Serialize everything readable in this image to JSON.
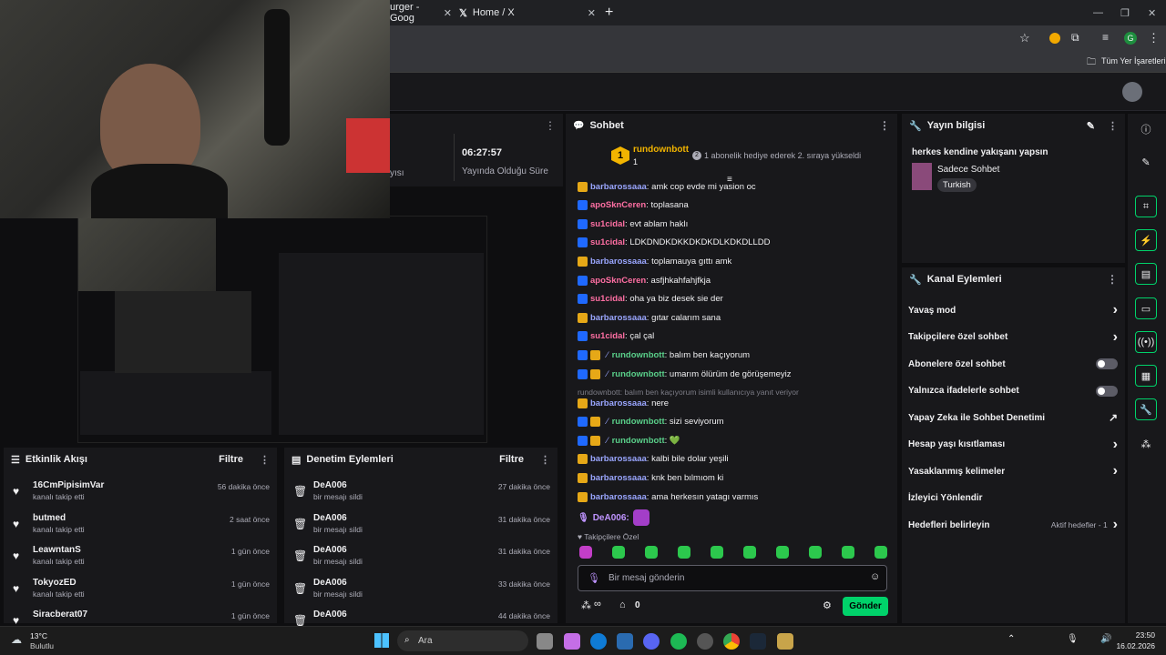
{
  "browser": {
    "tabs": [
      {
        "label": "urger - Goog"
      },
      {
        "label": "Home / X"
      }
    ],
    "new_tab": "+",
    "bookmark_label": "Tüm Yer İşaretleri",
    "profile_initial": "G"
  },
  "stream_stats": {
    "time_value": "06:27:57",
    "time_label": "Yayında Olduğu Süre",
    "partial_label": "yısı"
  },
  "chat": {
    "title": "Sohbet",
    "hype": {
      "rank": "1",
      "user": "rundownbott",
      "count": "1",
      "text": "1 abonelik hediye ederek 2. sıraya yükseldi",
      "sub_num": "2"
    },
    "messages": [
      {
        "user": "barbarossaaa",
        "text": "amk cop evde mi yasion oc",
        "ucolor": "u-blue",
        "badges": [
          "b-gold"
        ]
      },
      {
        "user": "apoSknCeren",
        "text": "toplasana",
        "ucolor": "u-pink",
        "badges": [
          "b-blue"
        ]
      },
      {
        "user": "su1cidal",
        "text": "evt ablam haklı",
        "ucolor": "u-pink",
        "badges": [
          "b-blue"
        ]
      },
      {
        "user": "su1cidal",
        "text": "LDKDNDKDKKDKDKDLKDKDLLDD",
        "ucolor": "u-pink",
        "badges": [
          "b-blue"
        ]
      },
      {
        "user": "barbarossaaa",
        "text": "toplamauya gıttı amk",
        "ucolor": "u-blue",
        "badges": [
          "b-gold"
        ]
      },
      {
        "user": "apoSknCeren",
        "text": "asfjhkahfahjfkja",
        "ucolor": "u-pink",
        "badges": [
          "b-blue"
        ]
      },
      {
        "user": "su1cidal",
        "text": "oha ya biz desek sie der",
        "ucolor": "u-pink",
        "badges": [
          "b-blue"
        ]
      },
      {
        "user": "barbarossaaa",
        "text": "gıtar calarım sana",
        "ucolor": "u-blue",
        "badges": [
          "b-gold"
        ]
      },
      {
        "user": "su1cidal",
        "text": "çal çal",
        "ucolor": "u-pink",
        "badges": [
          "b-blue"
        ]
      },
      {
        "user": "rundownbott",
        "text": "balım ben kaçıyorum",
        "ucolor": "u-green",
        "badges": [
          "b-blue",
          "b-gold"
        ]
      },
      {
        "user": "rundownbott",
        "text": "umarım ölürüm de görüşemeyiz",
        "ucolor": "u-green",
        "badges": [
          "b-blue",
          "b-gold"
        ]
      }
    ],
    "reply_note": "rundownbott: balım ben kaçıyorum isimli kullanıcıya yanıt veriyor",
    "messages2": [
      {
        "user": "barbarossaaa",
        "text": "nere",
        "ucolor": "u-blue",
        "badges": [
          "b-gold"
        ]
      },
      {
        "user": "rundownbott",
        "text": "sizi seviyorum",
        "ucolor": "u-green",
        "badges": [
          "b-blue",
          "b-gold"
        ]
      },
      {
        "user": "rundownbott",
        "text": "💚",
        "ucolor": "u-green",
        "badges": [
          "b-blue",
          "b-gold"
        ]
      },
      {
        "user": "barbarossaaa",
        "text": "kalbi bile dolar yeşili",
        "ucolor": "u-blue",
        "badges": [
          "b-gold"
        ]
      },
      {
        "user": "barbarossaaa",
        "text": "knk ben bılmıom ki",
        "ucolor": "u-blue",
        "badges": [
          "b-gold"
        ]
      },
      {
        "user": "barbarossaaa",
        "text": "ama herkesın yatagı varmıs",
        "ucolor": "u-blue",
        "badges": [
          "b-gold"
        ]
      }
    ],
    "last_user": "DeA006:",
    "followers_only": "Takipçilere Özel",
    "input_placeholder": "Bir mesaj gönderin",
    "points": "0",
    "send_label": "Gönder",
    "infinity": "∞"
  },
  "stream_info": {
    "title": "Yayın bilgisi",
    "stream_title": "herkes kendine yakışanı yapsın",
    "category": "Sadece Sohbet",
    "tag": "Turkish"
  },
  "channel_actions": {
    "title": "Kanal Eylemleri",
    "items": [
      {
        "label": "Yavaş mod",
        "control": "chev"
      },
      {
        "label": "Takipçilere özel sohbet",
        "control": "chev"
      },
      {
        "label": "Abonelere özel sohbet",
        "control": "toggle"
      },
      {
        "label": "Yalnızca ifadelerle sohbet",
        "control": "toggle"
      },
      {
        "label": "Yapay Zeka ile Sohbet Denetimi",
        "control": "ext"
      },
      {
        "label": "Hesap yaşı kısıtlaması",
        "control": "chev"
      },
      {
        "label": "Yasaklanmış kelimeler",
        "control": "chev"
      },
      {
        "label": "İzleyici Yönlendir",
        "control": "none"
      },
      {
        "label": "Hedefleri belirleyin",
        "control": "chev"
      }
    ],
    "goals_status": "Aktif hedefler - 1"
  },
  "activity_feed": {
    "title": "Etkinlik Akışı",
    "filter": "Filtre",
    "items": [
      {
        "name": "16CmPipisimVar",
        "sub": "kanalı takip etti",
        "time": "56 dakika önce"
      },
      {
        "name": "butmed",
        "sub": "kanalı takip etti",
        "time": "2 saat önce"
      },
      {
        "name": "LeawntanS",
        "sub": "kanalı takip etti",
        "time": "1 gün önce"
      },
      {
        "name": "TokyozED",
        "sub": "kanalı takip etti",
        "time": "1 gün önce"
      },
      {
        "name": "Siracberat07",
        "sub": "",
        "time": "1 gün önce"
      }
    ]
  },
  "mod_actions": {
    "title": "Denetim Eylemleri",
    "filter": "Filtre",
    "items": [
      {
        "name": "DeA006",
        "sub": "bir mesajı sildi",
        "time": "27 dakika önce"
      },
      {
        "name": "DeA006",
        "sub": "bir mesajı sildi",
        "time": "31 dakika önce"
      },
      {
        "name": "DeA006",
        "sub": "bir mesajı sildi",
        "time": "31 dakika önce"
      },
      {
        "name": "DeA006",
        "sub": "bir mesajı sildi",
        "time": "33 dakika önce"
      },
      {
        "name": "DeA006",
        "sub": "",
        "time": "44 dakika önce"
      }
    ]
  },
  "taskbar": {
    "weather_temp": "13°C",
    "weather_desc": "Bulutlu",
    "search_placeholder": "Ara",
    "time": "23:50",
    "date": "16.02.2026"
  }
}
